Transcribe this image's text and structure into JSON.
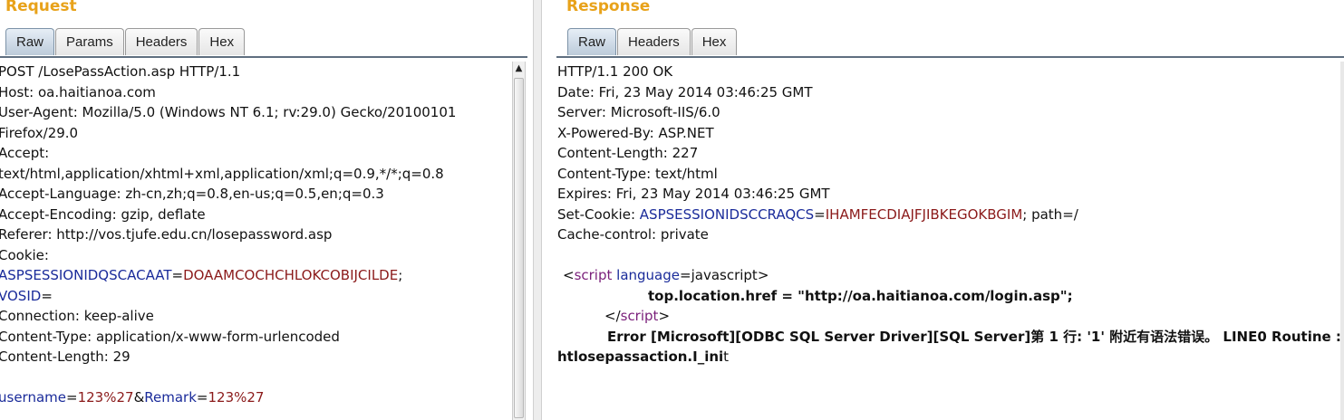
{
  "request": {
    "title": "Request",
    "tabs": [
      "Raw",
      "Params",
      "Headers",
      "Hex"
    ],
    "active_tab": "Raw",
    "lines": {
      "l0": "POST /LosePassAction.asp HTTP/1.1",
      "l1": "Host: oa.haitianoa.com",
      "l2": "User-Agent: Mozilla/5.0 (Windows NT 6.1; rv:29.0) Gecko/20100101",
      "l3": "Firefox/29.0",
      "l4": "Accept:",
      "l5": "text/html,application/xhtml+xml,application/xml;q=0.9,*/*;q=0.8",
      "l6": "Accept-Language: zh-cn,zh;q=0.8,en-us;q=0.5,en;q=0.3",
      "l7": "Accept-Encoding: gzip, deflate",
      "l8": "Referer: http://vos.tjufe.edu.cn/losepassword.asp",
      "l9": "Cookie:",
      "l10_name": "ASPSESSIONIDQSCACAAT",
      "l10_eq": "=",
      "l10_value": "DOAAMCOCHCHLOKCOBIJCILDE",
      "l10_semi": ";",
      "l11_name": "VOSID",
      "l11_eq": "=",
      "l12": "Connection: keep-alive",
      "l13": "Content-Type: application/x-www-form-urlencoded",
      "l14": "Content-Length: 29",
      "l16_p1_name": "username",
      "l16_p1_eq": "=",
      "l16_p1_value": "123%27",
      "l16_amp": "&",
      "l16_p2_name": "Remark",
      "l16_p2_eq": "=",
      "l16_p2_value": "123%27"
    }
  },
  "response": {
    "title": "Response",
    "tabs": [
      "Raw",
      "Headers",
      "Hex"
    ],
    "active_tab": "Raw",
    "lines": {
      "l0": "HTTP/1.1 200 OK",
      "l1": "Date: Fri, 23 May 2014 03:46:25 GMT",
      "l2": "Server: Microsoft-IIS/6.0",
      "l3": "X-Powered-By: ASP.NET",
      "l4": "Content-Length: 227",
      "l5": "Content-Type: text/html",
      "l6": "Expires: Fri, 23 May 2014 03:46:25 GMT",
      "l7_key": "Set-Cookie: ",
      "l7_name": "ASPSESSIONIDSCCRAQCS",
      "l7_eq": "=",
      "l7_value": "IHAMFECDIAJFJIBKEGOKBGIM",
      "l7_rest": "; path=/",
      "l8": "Cache-control: private",
      "l10_open": "<",
      "l10_tag": "script",
      "l10_attr": " language",
      "l10_eq": "=",
      "l10_val": "javascript",
      "l10_close": ">",
      "l11": "top.location.href = \"http://oa.haitianoa.com/login.asp\";",
      "l12_open": "</",
      "l12_tag": "script",
      "l12_close": ">",
      "l13": "Error [Microsoft][ODBC SQL Server Driver][SQL Server]第 1 行: '1' 附近有语法错误。 LINE0 Routine :",
      "l14_bold": "htlosepassaction.I_ini",
      "l14_rest": "t"
    }
  }
}
